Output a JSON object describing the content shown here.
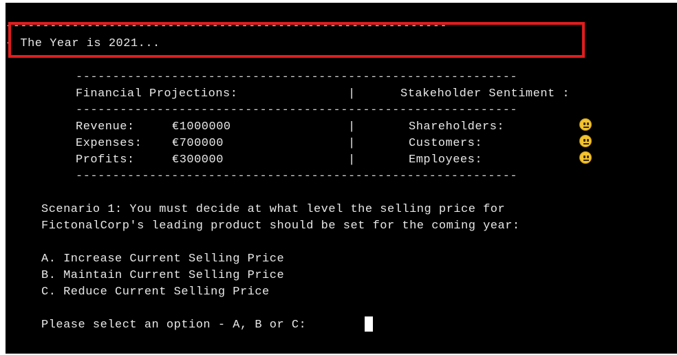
{
  "header": {
    "divider": "------------------------------------------------------------",
    "year_line": "- The Year is 2021..."
  },
  "dashboard": {
    "divider": "------------------------------------------------------------",
    "financial_heading": "Financial Projections:",
    "separator": "|",
    "stakeholder_heading": "Stakeholder Sentiment :",
    "financials": [
      {
        "label": "Revenue:",
        "value": "€1000000"
      },
      {
        "label": "Expenses:",
        "value": "€700000"
      },
      {
        "label": "Profits:",
        "value": "€300000"
      }
    ],
    "stakeholders": [
      {
        "label": "Shareholders:",
        "sentiment_icon": "neutral-face-icon"
      },
      {
        "label": "Customers:",
        "sentiment_icon": "neutral-face-icon"
      },
      {
        "label": "Employees:",
        "sentiment_icon": "neutral-face-icon"
      }
    ]
  },
  "scenario": {
    "line1": "Scenario 1: You must decide at what level the selling price for",
    "line2": "FictonalCorp's leading product should be set for the coming year:"
  },
  "options": [
    "A. Increase Current Selling Price",
    "B. Maintain Current Selling Price",
    "C. Reduce Current Selling Price"
  ],
  "prompt": {
    "text": "Please select an option - A, B or C:",
    "input_value": ""
  },
  "colors": {
    "background": "#000000",
    "text": "#e8e8e8",
    "highlight": "#e11d1d",
    "emoji": "#f2c230"
  }
}
